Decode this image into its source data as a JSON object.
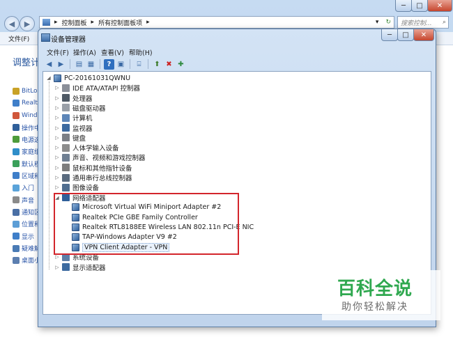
{
  "background_window": {
    "address_parts": [
      "控制面板",
      "所有控制面板项"
    ],
    "search_placeholder": "搜索控制...",
    "menu": [
      "文件(F)",
      "编"
    ],
    "heading": "调整计",
    "items": [
      {
        "label": "BitLo",
        "color": "#c9a227"
      },
      {
        "label": "Realt",
        "color": "#3f7fc9"
      },
      {
        "label": "Wind",
        "color": "#d0573b"
      },
      {
        "label": "操作中",
        "color": "#2f5f9a"
      },
      {
        "label": "电源选",
        "color": "#4e9c3b"
      },
      {
        "label": "家庭组",
        "color": "#2f8ec9"
      },
      {
        "label": "默认程",
        "color": "#3aa05a"
      },
      {
        "label": "区域和",
        "color": "#3f7fc9"
      },
      {
        "label": "入门",
        "color": "#5aa3d9"
      },
      {
        "label": "声音",
        "color": "#8a8a8a"
      },
      {
        "label": "通知区",
        "color": "#4a6fa5"
      },
      {
        "label": "位置和",
        "color": "#5c9ed6"
      },
      {
        "label": "显示",
        "color": "#3f7fc9"
      },
      {
        "label": "疑难解",
        "color": "#4a7bb5"
      },
      {
        "label": "桌面小",
        "color": "#5c7fb0"
      }
    ]
  },
  "device_manager": {
    "title": "设备管理器",
    "menu": [
      "文件(F)",
      "操作(A)",
      "查看(V)",
      "帮助(H)"
    ],
    "toolbar_icons": [
      "back-arrow-icon",
      "forward-arrow-icon",
      "show-hide-tree-icon",
      "properties-icon",
      "help-icon",
      "view-icon",
      "update-driver-icon",
      "uninstall-icon",
      "scan-hardware-icon"
    ],
    "root": "PC-20161031QWNU",
    "categories": [
      {
        "label": "IDE ATA/ATAPI 控制器",
        "icon_color": "#8a8f99",
        "expanded": false
      },
      {
        "label": "处理器",
        "icon_color": "#4f5a66",
        "expanded": false
      },
      {
        "label": "磁盘驱动器",
        "icon_color": "#9aa0a8",
        "expanded": false
      },
      {
        "label": "计算机",
        "icon_color": "#5d86b8",
        "expanded": false
      },
      {
        "label": "监视器",
        "icon_color": "#3c6aa0",
        "expanded": false
      },
      {
        "label": "键盘",
        "icon_color": "#7b7f86",
        "expanded": false
      },
      {
        "label": "人体学输入设备",
        "icon_color": "#8c8c8c",
        "expanded": false
      },
      {
        "label": "声音、视频和游戏控制器",
        "icon_color": "#6f7f92",
        "expanded": false
      },
      {
        "label": "鼠标和其他指针设备",
        "icon_color": "#7d7d7d",
        "expanded": false
      },
      {
        "label": "通用串行总线控制器",
        "icon_color": "#5a6b7f",
        "expanded": false
      },
      {
        "label": "图像设备",
        "icon_color": "#4f6d8f",
        "expanded": false
      },
      {
        "label": "网络适配器",
        "icon_color": "#2f5f9a",
        "expanded": true
      },
      {
        "label": "系统设备",
        "icon_color": "#5d7fa8",
        "expanded": false
      },
      {
        "label": "显示适配器",
        "icon_color": "#3c6aa0",
        "expanded": false
      }
    ],
    "network_adapters": [
      "Microsoft Virtual WiFi Miniport Adapter #2",
      "Realtek PCIe GBE Family Controller",
      "Realtek RTL8188EE Wireless LAN 802.11n PCI-E NIC",
      "TAP-Windows Adapter V9 #2",
      "VPN Client Adapter - VPN"
    ],
    "selected_adapter_index": 4
  },
  "watermark": {
    "title": "百科全说",
    "subtitle": "助你轻松解决"
  }
}
